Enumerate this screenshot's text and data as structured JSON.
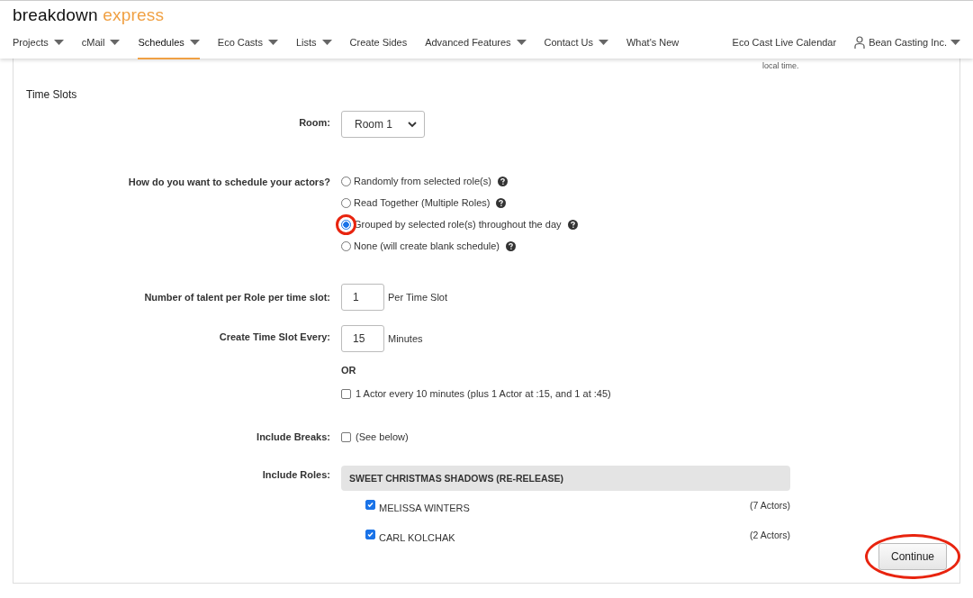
{
  "logo": {
    "part_1": "breakdown",
    "part_2": "express"
  },
  "nav": [
    {
      "label": "Projects",
      "dropdown": true,
      "selected": false
    },
    {
      "label": "cMail",
      "dropdown": true,
      "selected": false
    },
    {
      "label": "Schedules",
      "dropdown": true,
      "selected": true
    },
    {
      "label": "Eco Casts",
      "dropdown": true,
      "selected": false
    },
    {
      "label": "Lists",
      "dropdown": true,
      "selected": false
    },
    {
      "label": "Create Sides",
      "dropdown": false,
      "selected": false
    },
    {
      "label": "Advanced Features",
      "dropdown": true,
      "selected": false
    },
    {
      "label": "Contact Us",
      "dropdown": true,
      "selected": false
    },
    {
      "label": "What's New",
      "dropdown": false,
      "selected": false
    }
  ],
  "nav_right": {
    "calendar": "Eco Cast Live Calendar",
    "account": "Bean Casting Inc."
  },
  "timezone_note": "local time.",
  "section_title": "Time Slots",
  "room": {
    "label": "Room:",
    "value": "Room 1"
  },
  "schedule": {
    "label": "How do you want to schedule your actors?",
    "options": [
      {
        "label": "Randomly from selected role(s)",
        "selected": false
      },
      {
        "label": "Read Together (Multiple Roles)",
        "selected": false
      },
      {
        "label": "Grouped by selected role(s) throughout the day",
        "selected": true
      },
      {
        "label": "None (will create blank schedule)",
        "selected": false
      }
    ]
  },
  "talent": {
    "label": "Number of talent per Role per time slot:",
    "value": "1",
    "unit": "Per Time Slot"
  },
  "interval": {
    "label": "Create Time Slot Every:",
    "value": "15",
    "unit": "Minutes",
    "or": "OR",
    "alt_label": "1 Actor every 10 minutes (plus 1 Actor at :15, and 1 at :45)",
    "alt_checked": false
  },
  "breaks": {
    "label": "Include Breaks:",
    "note": "(See below)",
    "checked": false
  },
  "roles": {
    "label": "Include Roles:",
    "project": "SWEET CHRISTMAS SHADOWS (RE-RELEASE)",
    "items": [
      {
        "name": "MELISSA WINTERS",
        "count": "(7 Actors)",
        "checked": true
      },
      {
        "name": "CARL KOLCHAK",
        "count": "(2 Actors)",
        "checked": true
      }
    ]
  },
  "continue_button": "Continue"
}
